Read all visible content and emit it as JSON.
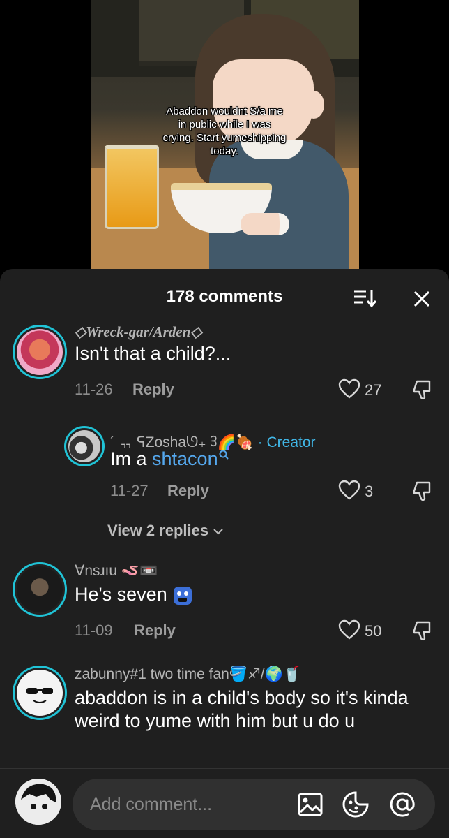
{
  "video": {
    "caption": "Abaddon wouldnt S/a me in public while I was crying. Start yumeshipping today."
  },
  "comments_panel": {
    "title": "178 comments",
    "accent_color": "#20c3d6",
    "creator_color": "#41b8e8"
  },
  "comments": [
    {
      "username": "◇Wreck-gar/Arden◇",
      "text": "Isn't that a child?...",
      "date": "11-26",
      "reply_label": "Reply",
      "likes": "27"
    },
    {
      "username": "´ ᆩ ᕋZoshaᘎ₊ ᢃ🌈🍖",
      "creator_badge": "· Creator",
      "text_prefix": "Im a ",
      "text_link": "shtacon",
      "date": "11-27",
      "reply_label": "Reply",
      "likes": "3"
    },
    {
      "username": "Ɐnsɹıu 🪱📼",
      "text": "He's seven",
      "date": "11-09",
      "reply_label": "Reply",
      "likes": "50"
    },
    {
      "username": "zabunny#1 two time fan🪣♐/🌍🥤",
      "text": "abaddon is in a child's body so it's kinda weird to yume with him but u do u"
    }
  ],
  "view_replies": "View 2 replies",
  "input": {
    "placeholder": "Add comment..."
  }
}
